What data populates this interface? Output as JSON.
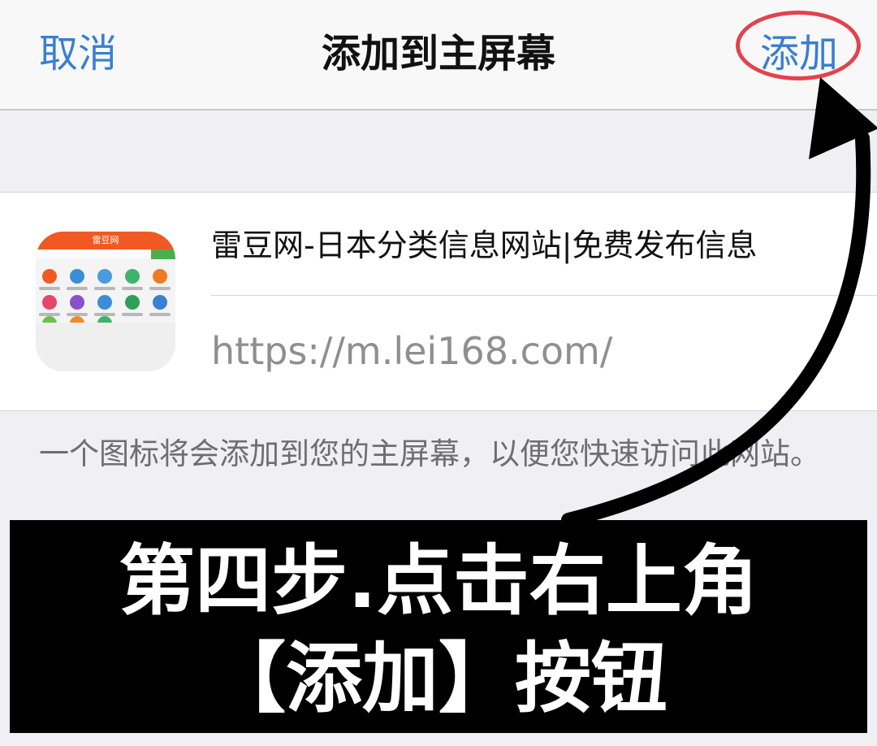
{
  "navbar": {
    "cancel_label": "取消",
    "title": "添加到主屏幕",
    "add_label": "添加"
  },
  "bookmark": {
    "app_icon_name": "lei168-site-icon",
    "app_icon_header_text": "雷豆网",
    "site_title": "雷豆网-日本分类信息网站|免费发布信息",
    "url": "https://m.lei168.com/"
  },
  "hint_text": "一个图标将会添加到您的主屏幕，以便您快速访问此网站。",
  "annotation": {
    "instruction_line1": "第四步.点击右上角",
    "instruction_line2": "【添加】按钮",
    "highlight_color": "#e2434c",
    "arrow_color": "#000000"
  },
  "colors": {
    "ios_blue": "#3a7fd0",
    "background": "#efeff4",
    "navbar": "#f8f8f8"
  }
}
